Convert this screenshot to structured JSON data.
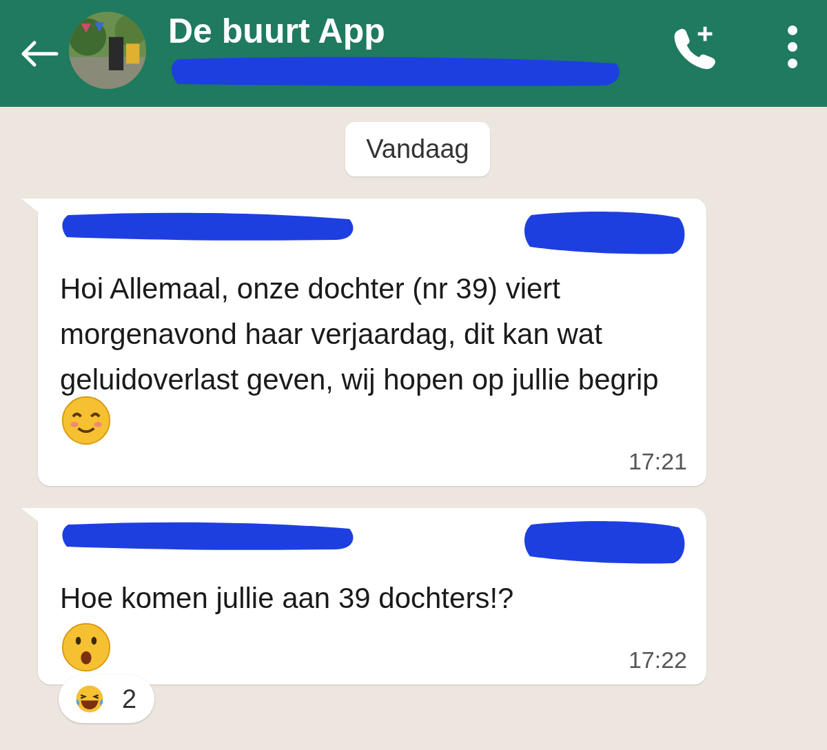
{
  "header": {
    "title": "De buurt App"
  },
  "date_chip": "Vandaag",
  "messages": [
    {
      "text": "Hoi Allemaal, onze dochter (nr 39) viert morgenavond haar verjaardag, dit kan wat geluidoverlast geven, wij hopen op jullie begrip",
      "time": "17:21"
    },
    {
      "text": "Hoe komen jullie aan 39 dochters!?",
      "time": "17:22",
      "reaction_count": "2"
    }
  ]
}
